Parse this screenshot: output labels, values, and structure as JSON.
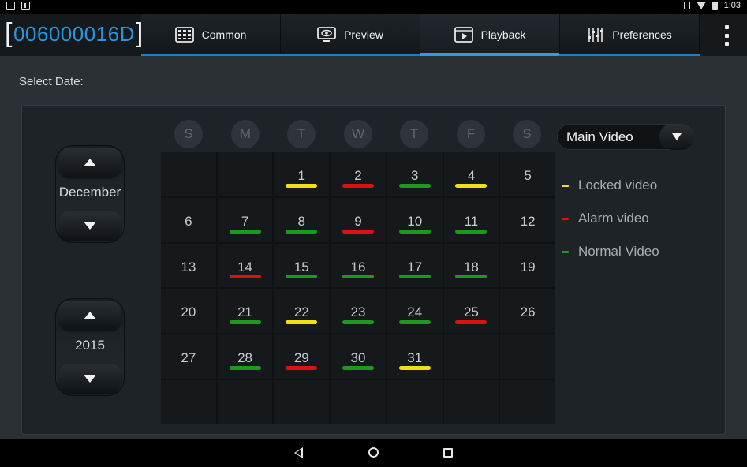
{
  "status_bar": {
    "time": "1:03"
  },
  "header": {
    "device_id": "006000016D",
    "tabs": [
      {
        "label": "Common",
        "icon": "grid-icon",
        "active": false
      },
      {
        "label": "Preview",
        "icon": "eye-monitor-icon",
        "active": false
      },
      {
        "label": "Playback",
        "icon": "video-play-icon",
        "active": true
      },
      {
        "label": "Preferences",
        "icon": "sliders-icon",
        "active": false
      }
    ],
    "overflow_icon": "more-vert-icon"
  },
  "select_date_label": "Select Date:",
  "month_spinner": {
    "value": "December"
  },
  "year_spinner": {
    "value": "2015"
  },
  "weekdays": [
    "S",
    "M",
    "T",
    "W",
    "T",
    "F",
    "S"
  ],
  "colors": {
    "locked": "#f0e010",
    "alarm": "#e01010",
    "normal": "#1d9a1d",
    "accent": "#2796e0"
  },
  "calendar": {
    "cells": [
      {
        "day": "",
        "mark": ""
      },
      {
        "day": "",
        "mark": ""
      },
      {
        "day": "1",
        "mark": "locked"
      },
      {
        "day": "2",
        "mark": "alarm"
      },
      {
        "day": "3",
        "mark": "normal"
      },
      {
        "day": "4",
        "mark": "locked"
      },
      {
        "day": "5",
        "mark": ""
      },
      {
        "day": "6",
        "mark": ""
      },
      {
        "day": "7",
        "mark": "normal"
      },
      {
        "day": "8",
        "mark": "normal"
      },
      {
        "day": "9",
        "mark": "alarm"
      },
      {
        "day": "10",
        "mark": "normal"
      },
      {
        "day": "11",
        "mark": "normal"
      },
      {
        "day": "12",
        "mark": ""
      },
      {
        "day": "13",
        "mark": ""
      },
      {
        "day": "14",
        "mark": "alarm"
      },
      {
        "day": "15",
        "mark": "normal"
      },
      {
        "day": "16",
        "mark": "normal"
      },
      {
        "day": "17",
        "mark": "normal"
      },
      {
        "day": "18",
        "mark": "normal"
      },
      {
        "day": "19",
        "mark": ""
      },
      {
        "day": "20",
        "mark": ""
      },
      {
        "day": "21",
        "mark": "normal"
      },
      {
        "day": "22",
        "mark": "locked"
      },
      {
        "day": "23",
        "mark": "normal"
      },
      {
        "day": "24",
        "mark": "normal"
      },
      {
        "day": "25",
        "mark": "alarm"
      },
      {
        "day": "26",
        "mark": ""
      },
      {
        "day": "27",
        "mark": ""
      },
      {
        "day": "28",
        "mark": "normal"
      },
      {
        "day": "29",
        "mark": "alarm"
      },
      {
        "day": "30",
        "mark": "normal"
      },
      {
        "day": "31",
        "mark": "locked"
      },
      {
        "day": "",
        "mark": ""
      },
      {
        "day": "",
        "mark": ""
      },
      {
        "day": "",
        "mark": ""
      },
      {
        "day": "",
        "mark": ""
      },
      {
        "day": "",
        "mark": ""
      },
      {
        "day": "",
        "mark": ""
      },
      {
        "day": "",
        "mark": ""
      },
      {
        "day": "",
        "mark": ""
      },
      {
        "day": "",
        "mark": ""
      }
    ]
  },
  "video_type_dropdown": {
    "selected": "Main Video"
  },
  "legend": [
    {
      "label": "Locked video",
      "type": "locked"
    },
    {
      "label": "Alarm video",
      "type": "alarm"
    },
    {
      "label": "Normal Video",
      "type": "normal"
    }
  ],
  "nav_bar": {
    "icons": [
      "back-icon",
      "home-icon",
      "recents-icon"
    ]
  }
}
